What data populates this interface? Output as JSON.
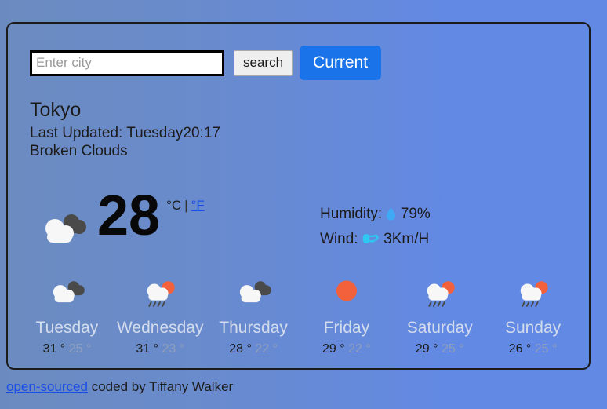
{
  "search": {
    "placeholder": "Enter city",
    "value": "",
    "search_label": "search",
    "current_label": "Current"
  },
  "current": {
    "city": "Tokyo",
    "last_updated": "Last Updated: Tuesday20:17",
    "condition": "Broken Clouds",
    "temperature": "28",
    "unit_celsius": "°C",
    "unit_separator": "|",
    "unit_fahrenheit": "°F",
    "icon": "broken-clouds-icon",
    "humidity_label": "Humidity:",
    "humidity_value": "79%",
    "humidity_icon": "water-drop-icon",
    "wind_label": "Wind:",
    "wind_value": "3Km/H",
    "wind_icon": "wind-dash-icon"
  },
  "forecast": [
    {
      "day": "Tuesday",
      "icon": "broken-clouds-icon",
      "high": "31 °",
      "low": "25 °"
    },
    {
      "day": "Wednesday",
      "icon": "sun-rain-icon",
      "high": "31 °",
      "low": "23 °"
    },
    {
      "day": "Thursday",
      "icon": "broken-clouds-icon",
      "high": "28 °",
      "low": "22 °"
    },
    {
      "day": "Friday",
      "icon": "sun-icon",
      "high": "29 °",
      "low": "22 °"
    },
    {
      "day": "Saturday",
      "icon": "sun-rain-icon",
      "high": "29 °",
      "low": "25 °"
    },
    {
      "day": "Sunday",
      "icon": "sun-rain-icon",
      "high": "26 °",
      "low": "25 °"
    }
  ],
  "footer": {
    "link_text": "open-sourced",
    "credit": "coded by Tiffany Walker"
  },
  "colors": {
    "accent": "#1a73e8",
    "link": "#1a4de8",
    "background_left": "#6b8bc0",
    "background_right": "#6289e4",
    "sun": "#f2603c",
    "drop": "#3fa9f5",
    "cloud_white": "#f7f7f7",
    "cloud_dark": "#4a4a4a"
  }
}
